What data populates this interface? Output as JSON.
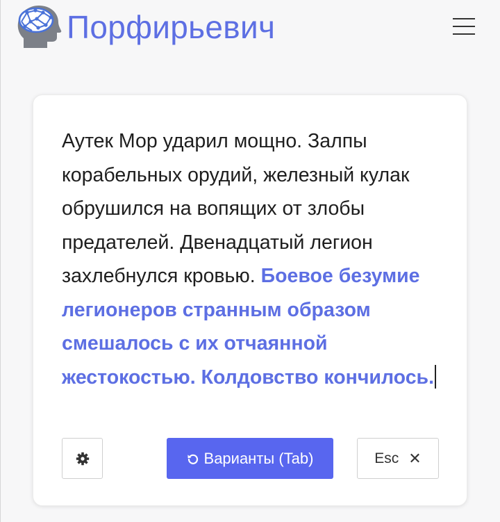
{
  "header": {
    "brand": "Порфирьевич"
  },
  "editor": {
    "user_text": "Аутек Мор ударил мощно. Залпы корабельных орудий, железный кулак обрушился на вопящих от злобы предателей. Двенадцатый легион захлебнулся кровью. ",
    "generated_text": "Боевое безумие легионеров странным образом смешалось с их отчаянной жестокостью. Колдовство кончилось."
  },
  "controls": {
    "settings_icon": "gear-icon",
    "variants_label": "Варианты (Tab)",
    "variants_icon": "reload-icon",
    "esc_label": "Esc",
    "esc_icon": "close-icon",
    "close_glyph": "✕"
  },
  "colors": {
    "accent": "#5d6fe3",
    "button_primary": "#5866ef",
    "text": "#1e1e1e"
  }
}
